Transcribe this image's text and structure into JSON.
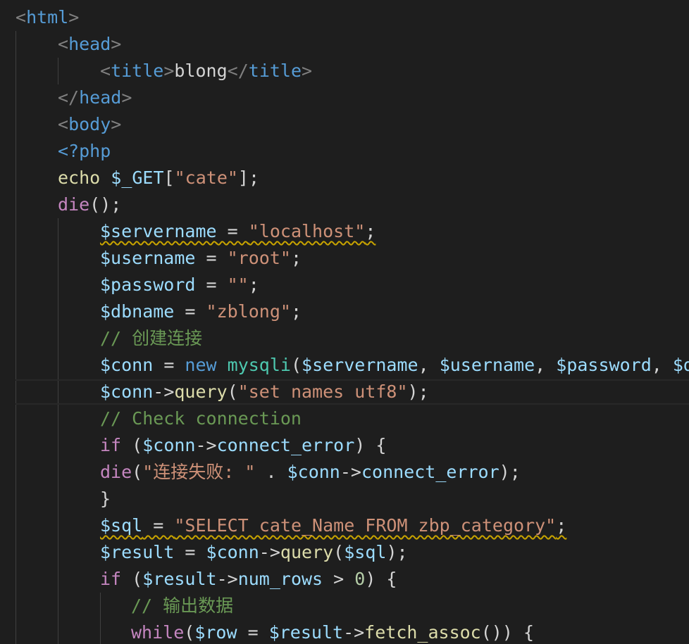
{
  "editor": {
    "theme_colors": {
      "background": "#1e1e1e",
      "tag": "#569cd6",
      "string": "#ce9178",
      "variable": "#9cdcfe",
      "function": "#dcdcaa",
      "keyword": "#c586c0",
      "comment": "#6a9955",
      "class": "#4ec9b0",
      "number": "#b5cea8",
      "warning_squiggle": "#c8a400"
    },
    "lines": [
      {
        "t": [
          [
            "tag-bracket",
            "<"
          ],
          [
            "tag-name",
            "html"
          ],
          [
            "tag-bracket",
            ">"
          ]
        ]
      },
      {
        "t": [
          [
            "tag-bracket",
            "<"
          ],
          [
            "tag-name",
            "head"
          ],
          [
            "tag-bracket",
            ">"
          ]
        ]
      },
      {
        "t": [
          [
            "tag-bracket",
            "<"
          ],
          [
            "tag-name",
            "title"
          ],
          [
            "tag-bracket",
            ">"
          ],
          [
            "text",
            "blong"
          ],
          [
            "tag-bracket",
            "</"
          ],
          [
            "tag-name",
            "title"
          ],
          [
            "tag-bracket",
            ">"
          ]
        ]
      },
      {
        "t": [
          [
            "tag-bracket",
            "</"
          ],
          [
            "tag-name",
            "head"
          ],
          [
            "tag-bracket",
            ">"
          ]
        ]
      },
      {
        "t": [
          [
            "tag-bracket",
            "<"
          ],
          [
            "tag-name",
            "body"
          ],
          [
            "tag-bracket",
            ">"
          ]
        ]
      },
      {
        "t": [
          [
            "php-tag",
            "<?php"
          ]
        ]
      },
      {
        "t": [
          [
            "fn",
            "echo"
          ],
          [
            "op",
            " "
          ],
          [
            "var",
            "$_GET"
          ],
          [
            "op",
            "["
          ],
          [
            "str",
            "\"cate\""
          ],
          [
            "op",
            "];"
          ]
        ]
      },
      {
        "t": [
          [
            "kw",
            "die"
          ],
          [
            "op",
            "();"
          ]
        ]
      },
      {
        "t": [
          [
            "var",
            "$servername"
          ],
          [
            "op",
            " = "
          ],
          [
            "str",
            "\"localhost\""
          ],
          [
            "op",
            ";"
          ]
        ]
      },
      {
        "t": [
          [
            "var",
            "$username"
          ],
          [
            "op",
            " = "
          ],
          [
            "str",
            "\"root\""
          ],
          [
            "op",
            ";"
          ]
        ]
      },
      {
        "t": [
          [
            "var",
            "$password"
          ],
          [
            "op",
            " = "
          ],
          [
            "str",
            "\"\""
          ],
          [
            "op",
            ";"
          ]
        ]
      },
      {
        "t": [
          [
            "var",
            "$dbname"
          ],
          [
            "op",
            " = "
          ],
          [
            "str",
            "\"zblong\""
          ],
          [
            "op",
            ";"
          ]
        ]
      },
      {
        "t": [
          [
            "comment",
            "// 创建连接"
          ]
        ]
      },
      {
        "t": [
          [
            "var",
            "$conn"
          ],
          [
            "op",
            " = "
          ],
          [
            "kw-blue",
            "new"
          ],
          [
            "op",
            " "
          ],
          [
            "type",
            "mysqli"
          ],
          [
            "op",
            "("
          ],
          [
            "var",
            "$servername"
          ],
          [
            "op",
            ", "
          ],
          [
            "var",
            "$username"
          ],
          [
            "op",
            ", "
          ],
          [
            "var",
            "$password"
          ],
          [
            "op",
            ", "
          ],
          [
            "var",
            "$d"
          ]
        ]
      },
      {
        "t": [
          [
            "var",
            "$conn"
          ],
          [
            "op",
            "->"
          ],
          [
            "fn",
            "query"
          ],
          [
            "op",
            "("
          ],
          [
            "str",
            "\"set names utf8\""
          ],
          [
            "op",
            ");"
          ]
        ]
      },
      {
        "t": [
          [
            "comment",
            "// Check connection"
          ]
        ]
      },
      {
        "t": [
          [
            "kw",
            "if"
          ],
          [
            "op",
            " ("
          ],
          [
            "var",
            "$conn"
          ],
          [
            "op",
            "->"
          ],
          [
            "var",
            "connect_error"
          ],
          [
            "op",
            ") {"
          ]
        ]
      },
      {
        "t": [
          [
            "kw",
            "die"
          ],
          [
            "op",
            "("
          ],
          [
            "str",
            "\"连接失败: \""
          ],
          [
            "op",
            " . "
          ],
          [
            "var",
            "$conn"
          ],
          [
            "op",
            "->"
          ],
          [
            "var",
            "connect_error"
          ],
          [
            "op",
            ");"
          ]
        ]
      },
      {
        "t": [
          [
            "op",
            "}"
          ]
        ]
      },
      {
        "t": [
          [
            "var",
            "$sql"
          ],
          [
            "op",
            " = "
          ],
          [
            "str",
            "\"SELECT cate_Name FROM zbp_category\""
          ],
          [
            "op",
            ";"
          ]
        ]
      },
      {
        "t": [
          [
            "var",
            "$result"
          ],
          [
            "op",
            " = "
          ],
          [
            "var",
            "$conn"
          ],
          [
            "op",
            "->"
          ],
          [
            "fn",
            "query"
          ],
          [
            "op",
            "("
          ],
          [
            "var",
            "$sql"
          ],
          [
            "op",
            ");"
          ]
        ]
      },
      {
        "t": [
          [
            "kw",
            "if"
          ],
          [
            "op",
            " ("
          ],
          [
            "var",
            "$result"
          ],
          [
            "op",
            "->"
          ],
          [
            "var",
            "num_rows"
          ],
          [
            "op",
            " > "
          ],
          [
            "num",
            "0"
          ],
          [
            "op",
            ") {"
          ]
        ]
      },
      {
        "t": [
          [
            "comment",
            "// 输出数据"
          ]
        ]
      },
      {
        "t": [
          [
            "kw",
            "while"
          ],
          [
            "op",
            "("
          ],
          [
            "var",
            "$row"
          ],
          [
            "op",
            " = "
          ],
          [
            "var",
            "$result"
          ],
          [
            "op",
            "->"
          ],
          [
            "fn",
            "fetch_assoc"
          ],
          [
            "op",
            "()) {"
          ]
        ]
      }
    ]
  }
}
